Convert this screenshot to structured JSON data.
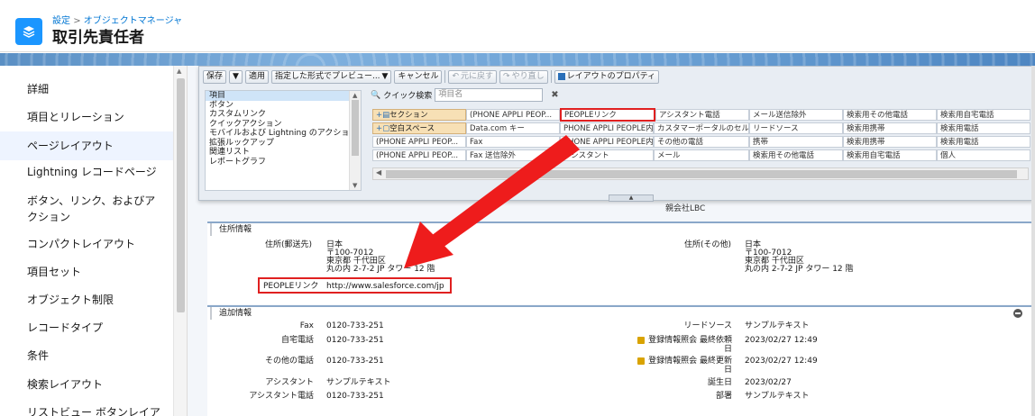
{
  "header": {
    "breadcrumb_settings": "設定",
    "breadcrumb_sep": ">",
    "breadcrumb_object_manager": "オブジェクトマネージャ",
    "title": "取引先責任者",
    "icon": "layers-icon"
  },
  "sidebar": {
    "items": [
      {
        "label": "詳細"
      },
      {
        "label": "項目とリレーション"
      },
      {
        "label": "ページレイアウト",
        "active": true
      },
      {
        "label": "Lightning レコードページ"
      },
      {
        "label": "ボタン、リンク、およびア"
      },
      {
        "label": "クション"
      },
      {
        "label": "コンパクトレイアウト"
      },
      {
        "label": "項目セット"
      },
      {
        "label": "オブジェクト制限"
      },
      {
        "label": "レコードタイプ"
      },
      {
        "label": "条件"
      },
      {
        "label": "検索レイアウト"
      },
      {
        "label": "リストビュー ボタンレイア"
      }
    ]
  },
  "toolbar": {
    "save": "保存",
    "apply": "適用",
    "preview": "指定した形式でプレビュー...",
    "cancel": "キャンセル",
    "undo": "元に戻す",
    "redo": "やり直し",
    "layout_props": "レイアウトのプロパティ"
  },
  "palette": {
    "categories": [
      "項目",
      "ボタン",
      "カスタムリンク",
      "クイックアクション",
      "モバイルおよび Lightning のアクション",
      "拡張ルックアップ",
      "関連リスト",
      "レポートグラフ"
    ],
    "quick_search_label": "クイック検索",
    "quick_search_placeholder": "項目名",
    "grid": [
      [
        "セクション",
        "(PHONE APPLI PEOP...",
        "PEOPLEリンク",
        "アシスタント電話",
        "メール送信除外",
        "検索用その他電話",
        "検索用自宅電話"
      ],
      [
        "空白スペース",
        "Data.com キー",
        "PHONE APPLI PEOPLE内",
        "カスタマーポータルのセルフ登",
        "リードソース",
        "検索用携帯",
        "検索用電話"
      ],
      [
        "(PHONE APPLI PEOP...",
        "Fax",
        "PHONE APPLI PEOPLE内",
        "その他の電話",
        "携帯",
        "検索用携帯",
        "検索用電話"
      ],
      [
        "(PHONE APPLI PEOP...",
        "Fax 送信除外",
        "アシスタント",
        "メール",
        "検索用その他電話",
        "検索用自宅電話",
        "個人"
      ]
    ]
  },
  "layout": {
    "lbc": "親会社LBC",
    "address_section": "住所情報",
    "mailing_label": "住所(郵送先)",
    "mailing_value": [
      "日本",
      "〒100-7012",
      "東京都 千代田区",
      "丸の内 2-7-2 JP タワー 12 階"
    ],
    "other_label": "住所(その他)",
    "other_value": [
      "日本",
      "〒100-7012",
      "東京都 千代田区",
      "丸の内 2-7-2 JP タワー 12 階"
    ],
    "people_link_label": "PEOPLEリンク",
    "people_link_value": "http://www.salesforce.com/jp",
    "additional_section": "追加情報",
    "left_fields": [
      {
        "label": "Fax",
        "value": "0120-733-251"
      },
      {
        "label": "自宅電話",
        "value": "0120-733-251"
      },
      {
        "label": "その他の電話",
        "value": "0120-733-251"
      },
      {
        "label": "アシスタント",
        "value": "サンプルテキスト"
      },
      {
        "label": "アシスタント電話",
        "value": "0120-733-251"
      }
    ],
    "right_fields": [
      {
        "label": "リードソース",
        "value": "サンプルテキスト"
      },
      {
        "label": "登録情報照会 最終依頼日",
        "value": "2023/02/27 12:49"
      },
      {
        "label": "登録情報照会 最終更新日",
        "value": "2023/02/27 12:49"
      },
      {
        "label": "誕生日",
        "value": "2023/02/27"
      },
      {
        "label": "部署",
        "value": "サンプルテキスト"
      }
    ]
  },
  "colors": {
    "accent": "#1b96ff",
    "highlight": "#e02020",
    "active_bg": "#eef4ff"
  }
}
